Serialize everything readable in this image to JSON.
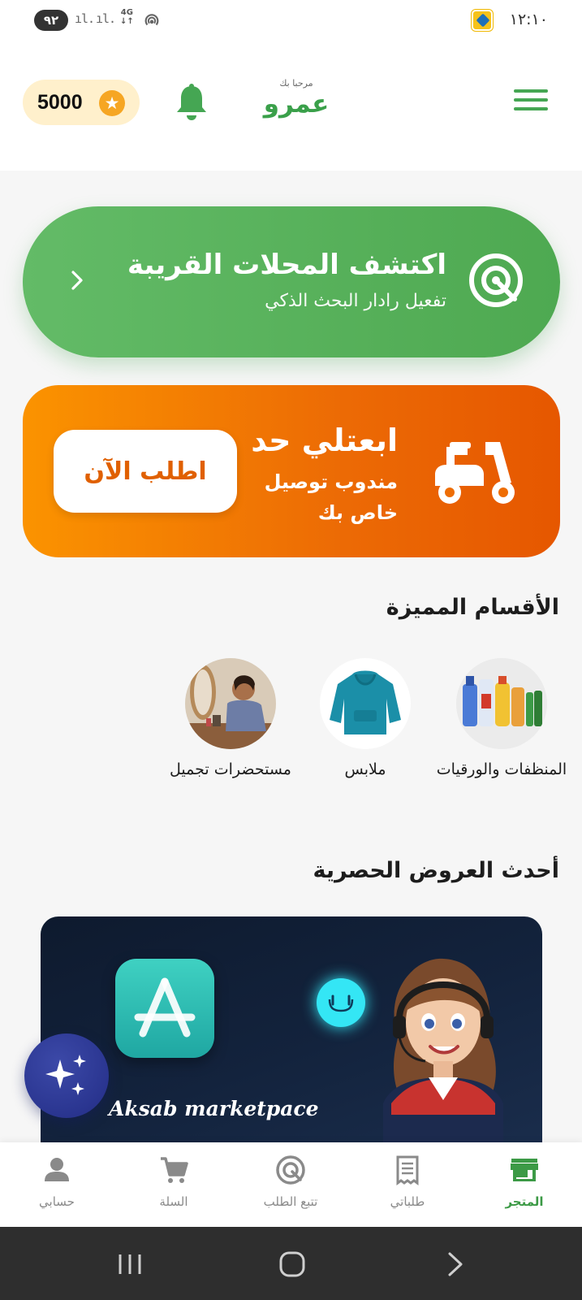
{
  "status_bar": {
    "battery": "٩٢",
    "signal_1": "ıl.",
    "signal_2": "ıl.",
    "network_type": "4G",
    "time": "١٢:١٠"
  },
  "header": {
    "points": "5000",
    "greeting": "مرحبا بك",
    "user_name": "عمرو"
  },
  "radar_banner": {
    "title": "اكتشف المحلات القريبة",
    "subtitle": "تفعيل رادار البحث الذكي"
  },
  "delivery_banner": {
    "title": "ابعتلي حد",
    "subtitle_line1": "مندوب توصيل",
    "subtitle_line2": "خاص بك",
    "button_label": "اطلب الآن"
  },
  "featured_categories": {
    "title": "الأقسام المميزة",
    "items": [
      {
        "label": "المنظفات والورقيات",
        "icon": "cleaning-products-image"
      },
      {
        "label": "ملابس",
        "icon": "hoodie-image"
      },
      {
        "label": "مستحضرات تجميل",
        "icon": "makeup-woman-image"
      }
    ]
  },
  "offers": {
    "title": "أحدث العروض الحصرية",
    "banner_text": "Aksab marketpace"
  },
  "bottom_nav": {
    "items": [
      {
        "label": "المتجر",
        "icon": "store-icon",
        "active": true
      },
      {
        "label": "طلباتي",
        "icon": "receipt-icon",
        "active": false
      },
      {
        "label": "تتبع الطلب",
        "icon": "track-icon",
        "active": false
      },
      {
        "label": "السلة",
        "icon": "cart-icon",
        "active": false
      },
      {
        "label": "حسابي",
        "icon": "person-icon",
        "active": false
      }
    ]
  },
  "colors": {
    "primary_green": "#4ea951",
    "orange": "#f07a05",
    "points_bg": "#fff0cc",
    "star": "#f6a623",
    "fab": "#2a3590"
  }
}
